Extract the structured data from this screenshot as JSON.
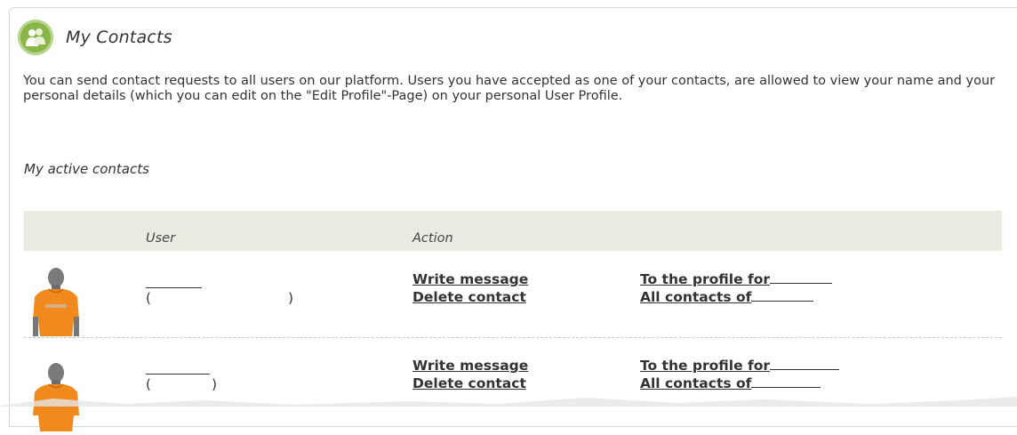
{
  "header": {
    "title": "My Contacts",
    "icon": "contacts-icon",
    "accent": "#8ab548"
  },
  "intro": "You can send contact requests to all users on our platform. Users you have accepted as one of your contacts, are allowed to view your name and your personal details (which you can edit on the \"Edit Profile\"-Page) on your personal User Profile.",
  "section_title": "My active contacts",
  "table": {
    "columns": {
      "user": "User",
      "action": "Action"
    },
    "rows": [
      {
        "user_open": "(",
        "user_close": ")",
        "write_message": "Write message",
        "delete_contact": "Delete contact",
        "profile_link": "To the profile for",
        "all_contacts_link": "All contacts of"
      },
      {
        "user_open": "(",
        "user_close": ")",
        "write_message": "Write message",
        "delete_contact": "Delete contact",
        "profile_link": "To the profile for",
        "all_contacts_link": "All contacts of"
      }
    ]
  }
}
